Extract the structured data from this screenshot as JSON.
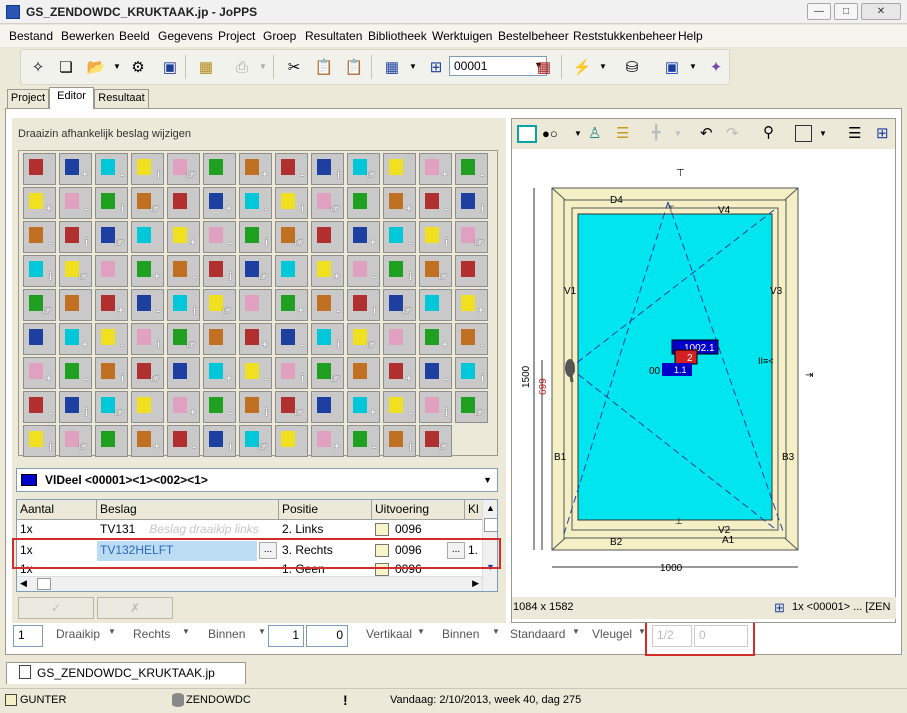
{
  "window": {
    "title": "GS_ZENDOWDC_KRUKTAAK.jp - JoPPS"
  },
  "menu": [
    "Bestand",
    "Bewerken",
    "Beeld",
    "Gegevens",
    "Project",
    "Groep",
    "Resultaten",
    "Bibliotheek",
    "Werktuigen",
    "Bestelbeheer",
    "Reststukkenbeheer",
    "Help"
  ],
  "toolbar": {
    "bom_number": "00001"
  },
  "tabs": [
    "Project",
    "Editor",
    "Resultaat"
  ],
  "left": {
    "header": "Draaizin afhankelijk beslag wijzigen",
    "element_dropdown": "VlDeel <00001><1><002><1>",
    "table": {
      "columns": [
        "Aantal",
        "Beslag",
        "Positie",
        "Uitvoering",
        "Kl"
      ],
      "rows": [
        {
          "aantal": "1x",
          "beslag": "TV131",
          "positie": "2. Links",
          "uitvoering": "0096",
          "extra": "Beslag draaikip links",
          "kl": ""
        },
        {
          "aantal": "1x",
          "beslag": "TV132HELFT",
          "positie": "3. Rechts",
          "uitvoering": "0096",
          "extra": "...",
          "kl": "1."
        },
        {
          "aantal": "1x",
          "beslag": "",
          "positie": "1. Geen",
          "uitvoering": "0096",
          "extra": "",
          "kl": ""
        }
      ]
    },
    "ok_label": "✓",
    "cancel_label": "✗",
    "status_fields": {
      "count": "1",
      "type": "Draaikip",
      "side": "Rechts",
      "dir": "Binnen",
      "v1": "1",
      "v2": "0",
      "orient": "Vertikaal",
      "dir2": "Binnen",
      "std": "Standaard",
      "vleugel": "Vleugel",
      "frac": "1/2",
      "frac_val": "0"
    }
  },
  "drawing": {
    "height_label": "1500",
    "handle_height": "699",
    "width_label": "1000",
    "labels": {
      "d4": "D4",
      "v4": "V4",
      "v1": "V1",
      "v3": "V3",
      "b1": "B1",
      "b3": "B3",
      "b2": "B2",
      "v2": "V2",
      "a1": "A1"
    },
    "tag1": "1002.1",
    "tag2": "2",
    "tag3": "00",
    "tag4": "1.1",
    "dims": "1084 x 1582",
    "status_text": "1x <00001> ... [ZEN"
  },
  "doc_tab": "GS_ZENDOWDC_KRUKTAAK.jp",
  "statusbar": {
    "user": "GUNTER",
    "db": "ZENDOWDC",
    "date": "Vandaag: 2/10/2013, week 40, dag 275"
  },
  "colors": {
    "glass": "#00e5ee",
    "frame": "#f5efc6",
    "accent_blue": "#0000c8",
    "highlight_red": "#d42b2b"
  }
}
